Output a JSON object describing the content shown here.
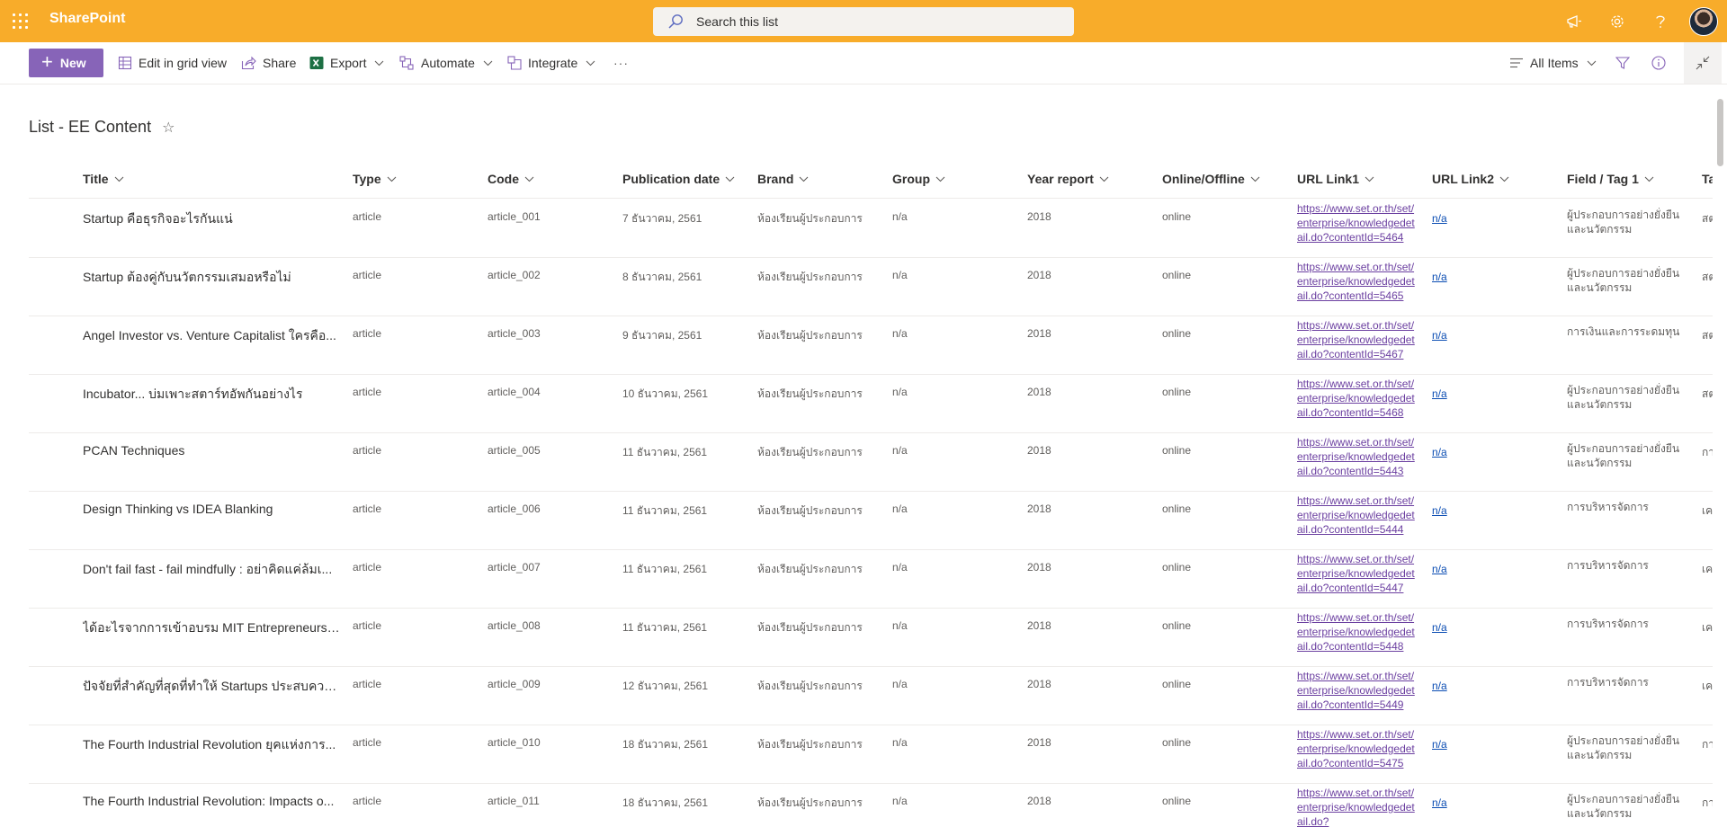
{
  "app": {
    "name": "SharePoint",
    "accent": "#f8ac2a",
    "new_button_color": "#8764b8"
  },
  "search": {
    "placeholder": "Search this list"
  },
  "suite_icons": [
    "megaphone-icon",
    "gear-icon",
    "help-icon",
    "avatar"
  ],
  "commands": {
    "new": "New",
    "edit_grid": "Edit in grid view",
    "share": "Share",
    "export": "Export",
    "automate": "Automate",
    "integrate": "Integrate",
    "more": "···",
    "view": "All Items"
  },
  "list": {
    "title": "List - EE Content"
  },
  "columns": [
    "Title",
    "Type",
    "Code",
    "Publication date",
    "Brand",
    "Group",
    "Year report",
    "Online/Offline",
    "URL Link1",
    "URL Link2",
    "Field / Tag 1",
    "Ta"
  ],
  "rows": [
    {
      "title": "Startup คือธุรกิจอะไรกันแน่",
      "type": "article",
      "code": "article_001",
      "date": "7 ธันวาคม, 2561",
      "brand": "ห้องเรียนผู้ประกอบการ",
      "group": "n/a",
      "year": "2018",
      "online": "online",
      "url1": "https://www.set.or.th/set/enterprise/knowledgedetail.do?contentId=5464",
      "url2": "n/a",
      "field": "ผู้ประกอบการอย่างยั่งยืนและนวัตกรรม",
      "tag2": "สต"
    },
    {
      "title": "Startup ต้องคู่กับนวัตกรรมเสมอหรือไม่",
      "type": "article",
      "code": "article_002",
      "date": "8 ธันวาคม, 2561",
      "brand": "ห้องเรียนผู้ประกอบการ",
      "group": "n/a",
      "year": "2018",
      "online": "online",
      "url1": "https://www.set.or.th/set/enterprise/knowledgedetail.do?contentId=5465",
      "url2": "n/a",
      "field": "ผู้ประกอบการอย่างยั่งยืนและนวัตกรรม",
      "tag2": "สต"
    },
    {
      "title": "Angel Investor vs. Venture Capitalist ใครคือ...",
      "type": "article",
      "code": "article_003",
      "date": "9 ธันวาคม, 2561",
      "brand": "ห้องเรียนผู้ประกอบการ",
      "group": "n/a",
      "year": "2018",
      "online": "online",
      "url1": "https://www.set.or.th/set/enterprise/knowledgedetail.do?contentId=5467",
      "url2": "n/a",
      "field": "การเงินและการระดมทุน",
      "tag2": "สต"
    },
    {
      "title": "Incubator... บ่มเพาะสตาร์ทอัพกันอย่างไร",
      "type": "article",
      "code": "article_004",
      "date": "10 ธันวาคม, 2561",
      "brand": "ห้องเรียนผู้ประกอบการ",
      "group": "n/a",
      "year": "2018",
      "online": "online",
      "url1": "https://www.set.or.th/set/enterprise/knowledgedetail.do?contentId=5468",
      "url2": "n/a",
      "field": "ผู้ประกอบการอย่างยั่งยืนและนวัตกรรม",
      "tag2": "สต"
    },
    {
      "title": "PCAN Techniques",
      "type": "article",
      "code": "article_005",
      "date": "11 ธันวาคม, 2561",
      "brand": "ห้องเรียนผู้ประกอบการ",
      "group": "n/a",
      "year": "2018",
      "online": "online",
      "url1": "https://www.set.or.th/set/enterprise/knowledgedetail.do?contentId=5443",
      "url2": "n/a",
      "field": "ผู้ประกอบการอย่างยั่งยืนและนวัตกรรม",
      "tag2": "กา"
    },
    {
      "title": "Design Thinking vs IDEA Blanking",
      "type": "article",
      "code": "article_006",
      "date": "11 ธันวาคม, 2561",
      "brand": "ห้องเรียนผู้ประกอบการ",
      "group": "n/a",
      "year": "2018",
      "online": "online",
      "url1": "https://www.set.or.th/set/enterprise/knowledgedetail.do?contentId=5444",
      "url2": "n/a",
      "field": "การบริหารจัดการ",
      "tag2": "เค"
    },
    {
      "title": "Don't fail fast - fail mindfully : อย่าคิดแค่ล้มเ...",
      "type": "article",
      "code": "article_007",
      "date": "11 ธันวาคม, 2561",
      "brand": "ห้องเรียนผู้ประกอบการ",
      "group": "n/a",
      "year": "2018",
      "online": "online",
      "url1": "https://www.set.or.th/set/enterprise/knowledgedetail.do?contentId=5447",
      "url2": "n/a",
      "field": "การบริหารจัดการ",
      "tag2": "เค"
    },
    {
      "title": "ได้อะไรจากการเข้าอบรม MIT Entrepreneurshi...",
      "type": "article",
      "code": "article_008",
      "date": "11 ธันวาคม, 2561",
      "brand": "ห้องเรียนผู้ประกอบการ",
      "group": "n/a",
      "year": "2018",
      "online": "online",
      "url1": "https://www.set.or.th/set/enterprise/knowledgedetail.do?contentId=5448",
      "url2": "n/a",
      "field": "การบริหารจัดการ",
      "tag2": "เค"
    },
    {
      "title": "ปัจจัยที่สำคัญที่สุดที่ทำให้ Startups ประสบควา...",
      "type": "article",
      "code": "article_009",
      "date": "12 ธันวาคม, 2561",
      "brand": "ห้องเรียนผู้ประกอบการ",
      "group": "n/a",
      "year": "2018",
      "online": "online",
      "url1": "https://www.set.or.th/set/enterprise/knowledgedetail.do?contentId=5449",
      "url2": "n/a",
      "field": "การบริหารจัดการ",
      "tag2": "เค"
    },
    {
      "title": "The Fourth Industrial Revolution ยุคแห่งการ...",
      "type": "article",
      "code": "article_010",
      "date": "18 ธันวาคม, 2561",
      "brand": "ห้องเรียนผู้ประกอบการ",
      "group": "n/a",
      "year": "2018",
      "online": "online",
      "url1": "https://www.set.or.th/set/enterprise/knowledgedetail.do?contentId=5475",
      "url2": "n/a",
      "field": "ผู้ประกอบการอย่างยั่งยืนและนวัตกรรม",
      "tag2": "กา"
    },
    {
      "title": "The Fourth Industrial Revolution: Impacts o...",
      "type": "article",
      "code": "article_011",
      "date": "18 ธันวาคม, 2561",
      "brand": "ห้องเรียนผู้ประกอบการ",
      "group": "n/a",
      "year": "2018",
      "online": "online",
      "url1": "https://www.set.or.th/set/enterprise/knowledgedetail.do?",
      "url2": "n/a",
      "field": "ผู้ประกอบการอย่างยั่งยืนและนวัตกรรม",
      "tag2": "กา"
    }
  ]
}
